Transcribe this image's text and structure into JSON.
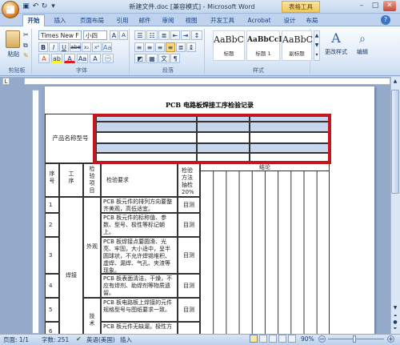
{
  "window": {
    "title": "新建文件.doc [兼容模式] - Microsoft Word",
    "table_tools": "表格工具"
  },
  "tabs": [
    "开始",
    "插入",
    "页面布局",
    "引用",
    "邮件",
    "审阅",
    "视图",
    "开发工具",
    "Acrobat",
    "设计",
    "布局"
  ],
  "ribbon": {
    "paste_label": "粘贴",
    "font_name": "Times New F",
    "font_size": "小四",
    "styles": [
      {
        "sample": "AaBbC",
        "name": "标题"
      },
      {
        "sample": "AaBbCcD",
        "name": "标题 1"
      },
      {
        "sample": "AaBbC",
        "name": "副标题"
      }
    ],
    "change_styles": "更改样式",
    "editing": "编辑",
    "groups": {
      "clipboard": "剪贴板",
      "font": "字体",
      "paragraph": "段落",
      "styles": "样式"
    }
  },
  "document": {
    "title": "PCB 电路板焊接工序检验记录",
    "product_label": "产品名称型号",
    "headers": {
      "seq": "序号",
      "process": "工序",
      "item": "检验项目",
      "requirement": "检验要求",
      "method": "检验方法抽检20%",
      "result": "结论"
    },
    "rows": [
      {
        "no": "1",
        "req": "PCB 板元件的排列方向要整齐美观，高低适宜。",
        "method": "目测"
      },
      {
        "no": "2",
        "req": "PCB 板元件的标称值、参数、型号、极性等标记朝上。",
        "method": "目测"
      },
      {
        "no": "3",
        "req": "PCB 板焊接点要圆滑、光亮、牢固，大小适中，呈半圆球状，不允许焊锡堆积、虚焊、漏焊、气孔、夹渣等现象。",
        "method": "目测"
      },
      {
        "no": "4",
        "req": "PCB 板表面清洁，干燥，不应有焊剂、助焊剂等物质遗留。",
        "method": "目测"
      },
      {
        "no": "5",
        "req": "PCB 板电路板上焊接的元件规格型号与图纸要求一致。",
        "method": "目测"
      },
      {
        "no": "6",
        "req": "PCB 板元件无缺漏，极性方",
        "method": ""
      }
    ],
    "process_name": "焊接",
    "item_appearance": "外观",
    "item_tech": "技术"
  },
  "status": {
    "page": "页面: 1/1",
    "words": "字数: 251",
    "language": "英语(美国)",
    "mode": "插入",
    "zoom": "90%"
  }
}
